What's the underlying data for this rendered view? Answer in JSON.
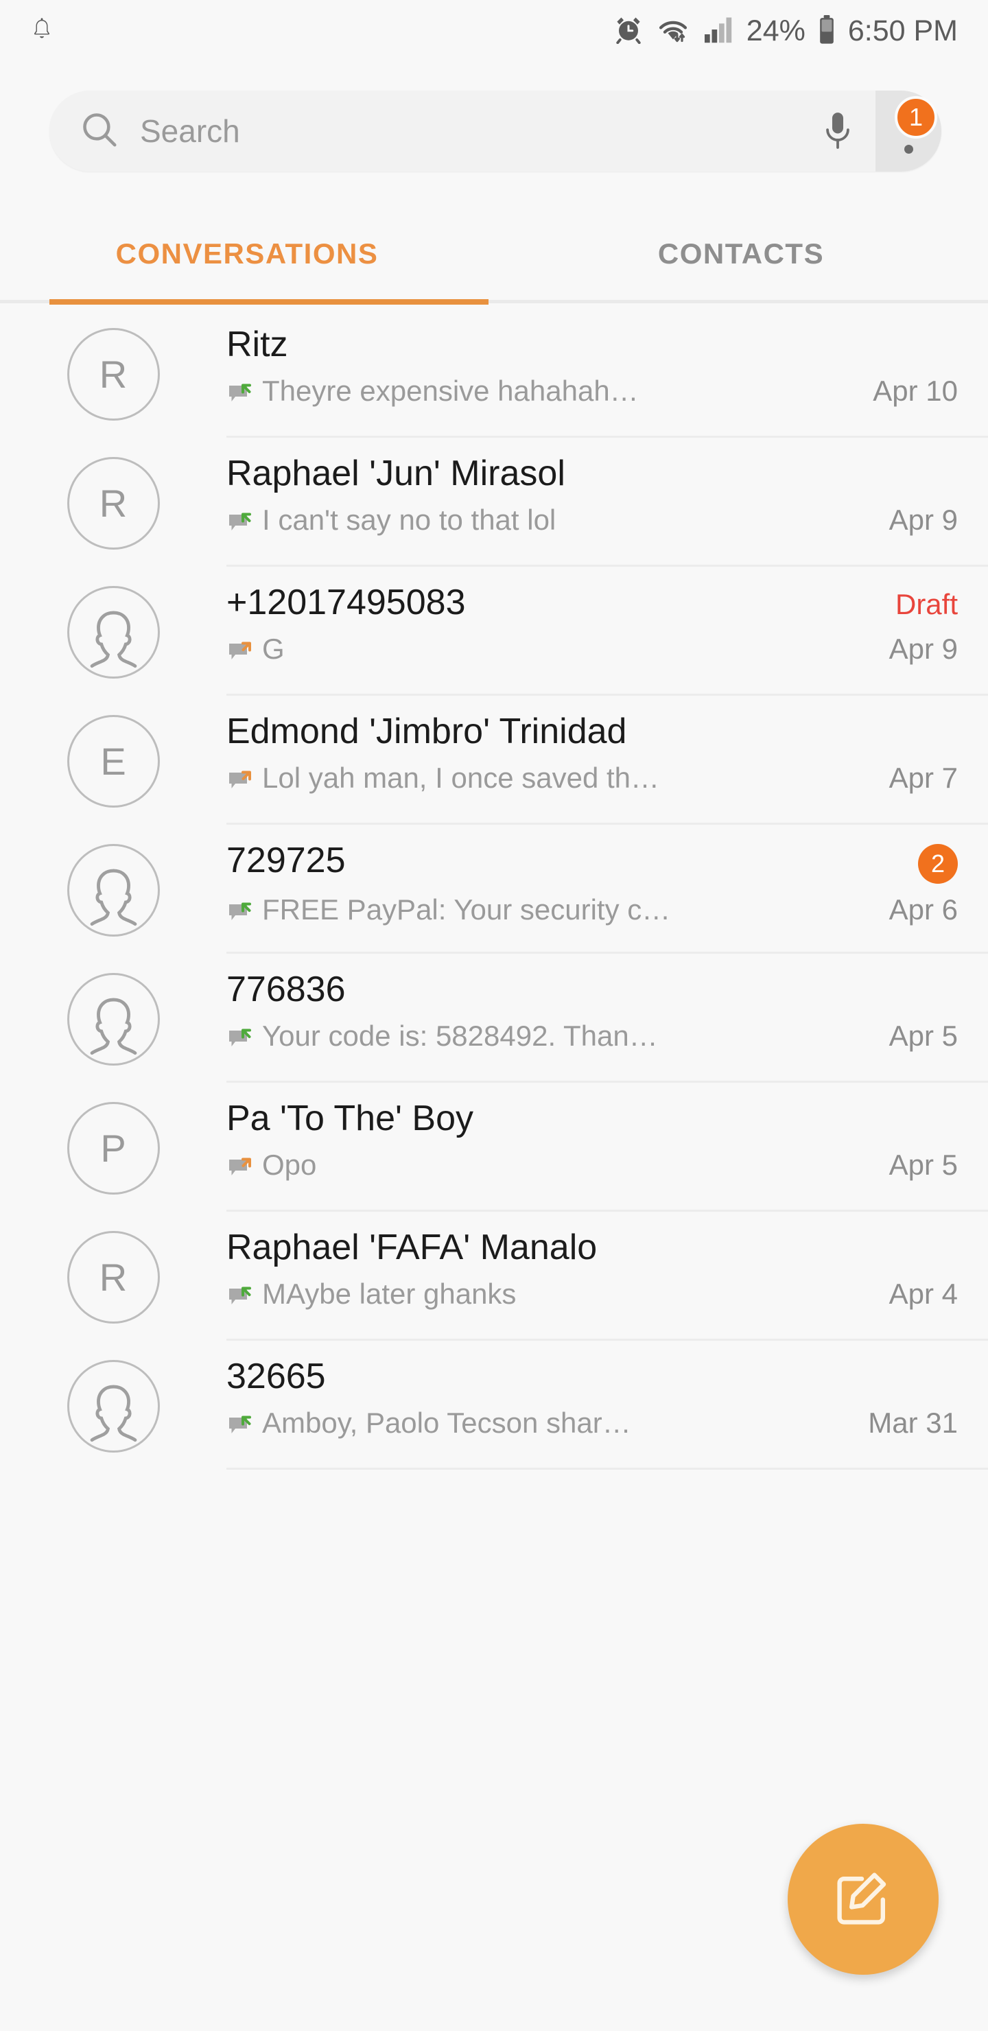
{
  "status_bar": {
    "notification_icon": "bell-icon",
    "alarm_icon": "alarm-clock-icon",
    "wifi_icon": "wifi-transfer-icon",
    "signal_icon": "cellular-signal-icon",
    "battery_percent": "24%",
    "battery_icon": "battery-icon",
    "time": "6:50 PM"
  },
  "search": {
    "placeholder": "Search",
    "value": "",
    "search_icon": "search-icon",
    "mic_icon": "microphone-icon",
    "more_icon": "overflow-menu-icon",
    "more_badge": "1"
  },
  "tabs": [
    {
      "label": "CONVERSATIONS",
      "active": true
    },
    {
      "label": "CONTACTS",
      "active": false
    }
  ],
  "colors": {
    "accent_orange": "#e8913f",
    "badge_orange": "#f1711d",
    "fab_orange": "#f0a84a",
    "draft_red": "#e8453c",
    "incoming_green": "#4faa3c",
    "outgoing_orange": "#e8913f",
    "background": "#f8f8f8"
  },
  "fab": {
    "icon": "compose-message-icon",
    "label": "New message"
  },
  "conversations": [
    {
      "avatar_type": "letter",
      "avatar_letter": "R",
      "name": "Ritz",
      "direction": "incoming",
      "snippet": "Theyre expensive hahahah…",
      "date": "Apr 10",
      "draft": "",
      "unread": ""
    },
    {
      "avatar_type": "letter",
      "avatar_letter": "R",
      "name": "Raphael 'Jun' Mirasol",
      "direction": "incoming",
      "snippet": "I can't say no to that lol",
      "date": "Apr 9",
      "draft": "",
      "unread": ""
    },
    {
      "avatar_type": "person",
      "avatar_letter": "",
      "name": "+12017495083",
      "direction": "outgoing",
      "snippet": "G",
      "date": "Apr 9",
      "draft": "Draft",
      "unread": ""
    },
    {
      "avatar_type": "letter",
      "avatar_letter": "E",
      "name": "Edmond 'Jimbro' Trinidad",
      "direction": "outgoing",
      "snippet": "Lol yah man, I once saved th…",
      "date": "Apr 7",
      "draft": "",
      "unread": ""
    },
    {
      "avatar_type": "person",
      "avatar_letter": "",
      "name": "729725",
      "direction": "incoming",
      "snippet": "FREE PayPal: Your security c…",
      "date": "Apr 6",
      "draft": "",
      "unread": "2"
    },
    {
      "avatar_type": "person",
      "avatar_letter": "",
      "name": "776836",
      "direction": "incoming",
      "snippet": "Your code is: 5828492. Than…",
      "date": "Apr 5",
      "draft": "",
      "unread": ""
    },
    {
      "avatar_type": "letter",
      "avatar_letter": "P",
      "name": "Pa 'To The' Boy",
      "direction": "outgoing",
      "snippet": "Opo",
      "date": "Apr 5",
      "draft": "",
      "unread": ""
    },
    {
      "avatar_type": "letter",
      "avatar_letter": "R",
      "name": "Raphael 'FAFA' Manalo",
      "direction": "incoming",
      "snippet": "MAybe later ghanks",
      "date": "Apr 4",
      "draft": "",
      "unread": ""
    },
    {
      "avatar_type": "person",
      "avatar_letter": "",
      "name": "32665",
      "direction": "incoming",
      "snippet": "Amboy, Paolo Tecson shar…",
      "date": "Mar 31",
      "draft": "",
      "unread": ""
    }
  ]
}
